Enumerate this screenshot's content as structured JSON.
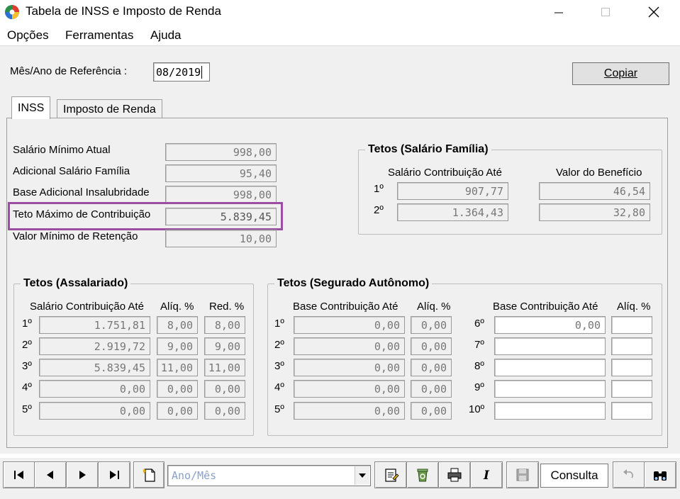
{
  "window": {
    "title": "Tabela de INSS e Imposto de Renda"
  },
  "menu": [
    "Opções",
    "Ferramentas",
    "Ajuda"
  ],
  "reference": {
    "label": "Mês/Ano de Referência :",
    "value": "08/2019"
  },
  "copy_button": "Copiar",
  "tabs": [
    "INSS",
    "Imposto de Renda"
  ],
  "inss": {
    "fields": [
      {
        "label": "Salário Mínimo Atual",
        "value": "998,00"
      },
      {
        "label": "Adicional Salário Família",
        "value": "95,40"
      },
      {
        "label": "Base Adicional Insalubridade",
        "value": "998,00"
      },
      {
        "label": "Teto Máximo de Contribuição",
        "value": "5.839,45"
      },
      {
        "label": "Valor Mínimo de Retenção",
        "value": "10,00"
      }
    ],
    "familia": {
      "title": "Tetos (Salário Família)",
      "col1": "Salário Contribuição Até",
      "col2": "Valor do Benefício",
      "rows": [
        {
          "n": "1º",
          "sal": "907,77",
          "val": "46,54"
        },
        {
          "n": "2º",
          "sal": "1.364,43",
          "val": "32,80"
        }
      ]
    },
    "assalariado": {
      "title": "Tetos (Assalariado)",
      "col1": "Salário Contribuição Até",
      "col2": "Alíq. %",
      "col3": "Red. %",
      "rows": [
        {
          "n": "1º",
          "sal": "1.751,81",
          "aliq": "8,00",
          "red": "8,00"
        },
        {
          "n": "2º",
          "sal": "2.919,72",
          "aliq": "9,00",
          "red": "9,00"
        },
        {
          "n": "3º",
          "sal": "5.839,45",
          "aliq": "11,00",
          "red": "11,00"
        },
        {
          "n": "4º",
          "sal": "0,00",
          "aliq": "0,00",
          "red": "0,00"
        },
        {
          "n": "5º",
          "sal": "0,00",
          "aliq": "0,00",
          "red": "0,00"
        }
      ]
    },
    "autonomo": {
      "title": "Tetos (Segurado Autônomo)",
      "col1": "Base Contribuição Até",
      "col2": "Alíq. %",
      "col3": "Base Contribuição Até",
      "col4": "Alíq. %",
      "left_rows": [
        {
          "n": "1º",
          "base": "0,00",
          "aliq": "0,00"
        },
        {
          "n": "2º",
          "base": "0,00",
          "aliq": "0,00"
        },
        {
          "n": "3º",
          "base": "0,00",
          "aliq": "0,00"
        },
        {
          "n": "4º",
          "base": "0,00",
          "aliq": "0,00"
        },
        {
          "n": "5º",
          "base": "0,00",
          "aliq": "0,00"
        }
      ],
      "right_rows": [
        {
          "n": "6º",
          "base": "0,00",
          "aliq": ""
        },
        {
          "n": "7º",
          "base": "",
          "aliq": ""
        },
        {
          "n": "8º",
          "base": "",
          "aliq": ""
        },
        {
          "n": "9º",
          "base": "",
          "aliq": ""
        },
        {
          "n": "10º",
          "base": "",
          "aliq": ""
        }
      ]
    }
  },
  "toolbar": {
    "combo_placeholder": "Ano/Mês",
    "status": "Consulta",
    "icons": [
      "first-record-icon",
      "prev-record-icon",
      "next-record-icon",
      "last-record-icon",
      "new-record-icon",
      "edit-icon",
      "recycle-icon",
      "print-icon",
      "italic-icon",
      "save-icon",
      "undo-icon",
      "binoculars-icon"
    ]
  },
  "colors": {
    "highlight": "#9b4fa3",
    "background": "#f0f0f0"
  }
}
